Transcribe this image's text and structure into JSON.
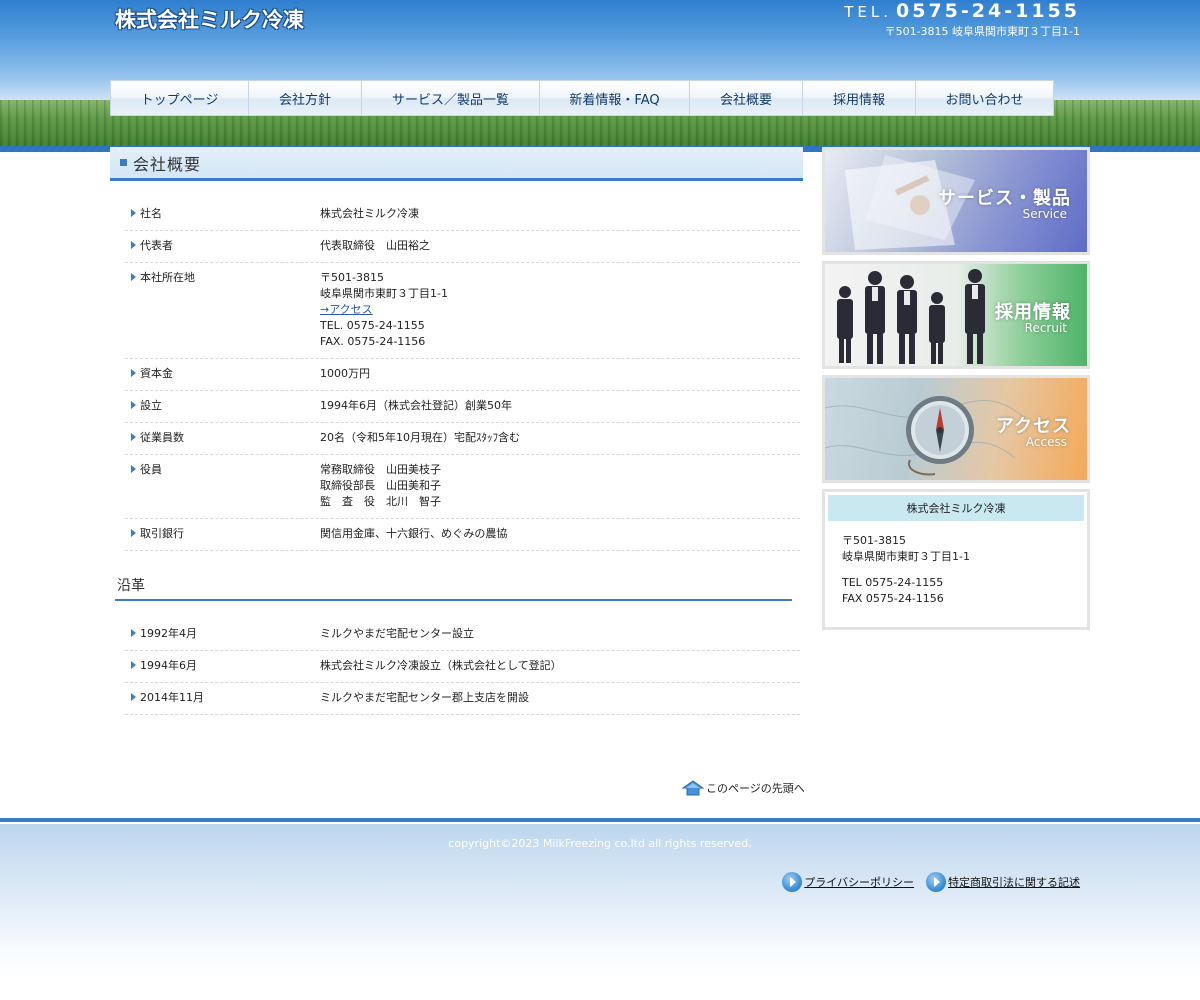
{
  "header": {
    "logo": "株式会社ミルク冷凍",
    "tel_prefix": "TEL.",
    "tel_number": "0575-24-1155",
    "address": "〒501-3815 岐阜県関市東町３丁目1-1"
  },
  "nav": {
    "items": [
      {
        "label": "トップページ"
      },
      {
        "label": "会社方針"
      },
      {
        "label": "サービス／製品一覧"
      },
      {
        "label": "新着情報・FAQ"
      },
      {
        "label": "会社概要"
      },
      {
        "label": "採用情報"
      },
      {
        "label": "お問い合わせ"
      }
    ]
  },
  "main": {
    "title": "会社概要",
    "rows": [
      {
        "label": "社名",
        "lines": [
          "株式会社ミルク冷凍"
        ]
      },
      {
        "label": "代表者",
        "lines": [
          "代表取締役　山田裕之"
        ]
      },
      {
        "label": "本社所在地",
        "lines": [
          "〒501-3815",
          "岐阜県関市東町３丁目1-1"
        ],
        "link": "→アクセス",
        "lines_after": [
          "TEL. 0575-24-1155",
          "FAX. 0575-24-1156"
        ]
      },
      {
        "label": "資本金",
        "lines": [
          "1000万円"
        ]
      },
      {
        "label": "設立",
        "lines": [
          "1994年6月（株式会社登記）創業50年"
        ]
      },
      {
        "label": "従業員数",
        "lines": [
          "20名（令和5年10月現在）宅配ｽﾀｯﾌ含む"
        ]
      },
      {
        "label": "役員",
        "lines": [
          "常務取締役　山田美枝子",
          "取締役部長　山田美和子",
          "監　査　役　北川　智子"
        ]
      },
      {
        "label": "取引銀行",
        "lines": [
          "関信用金庫、十六銀行、めぐみの農協"
        ]
      }
    ],
    "history_title": "沿革",
    "history": [
      {
        "label": "1992年4月",
        "text": "ミルクやまだ宅配センター設立"
      },
      {
        "label": "1994年6月",
        "text": "株式会社ミルク冷凍設立（株式会社として登記）"
      },
      {
        "label": "2014年11月",
        "text": "ミルクやまだ宅配センター郡上支店を開設"
      }
    ],
    "page_top": "このページの先頭へ"
  },
  "sidebar": {
    "banners": [
      {
        "title": "サービス・製品",
        "sub": "Service"
      },
      {
        "title": "採用情報",
        "sub": "Recruit"
      },
      {
        "title": "アクセス",
        "sub": "Access"
      }
    ],
    "company_box": {
      "title": "株式会社ミルク冷凍",
      "postal": "〒501-3815",
      "address": "岐阜県関市東町３丁目1-1",
      "tel": "TEL 0575-24-1155",
      "fax": "FAX 0575-24-1156"
    }
  },
  "footer": {
    "copyright": "copyright©2023 MilkFreezing  co.ltd all rights reserved.",
    "links": [
      {
        "label": "プライバシーポリシー"
      },
      {
        "label": "特定商取引法に関する記述"
      }
    ]
  },
  "colors": {
    "accent": "#3a7bc4",
    "header_blue": "#2f7fcf",
    "grass": "#4f8a3c",
    "company_box_title_bg": "#c9e8ef"
  }
}
